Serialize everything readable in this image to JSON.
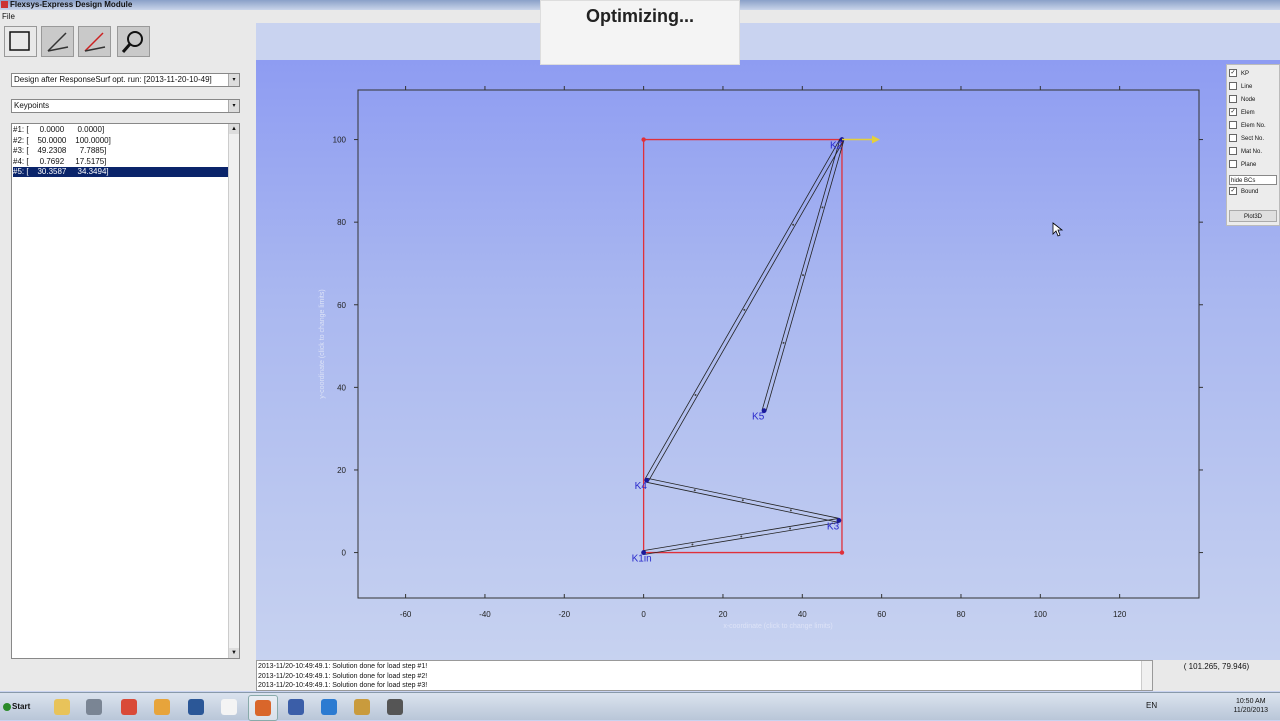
{
  "window": {
    "title": "Flexsys-Express Design Module"
  },
  "menu": {
    "file": "File"
  },
  "status_overlay": {
    "text": "Optimizing..."
  },
  "left": {
    "design_select": "Design after ResponseSurf opt. run: [2013-11-20-10-49]",
    "entity_select": "Keypoints",
    "keypoints": [
      "#1: [     0.0000      0.0000]",
      "#2: [    50.0000    100.0000]",
      "#3: [    49.2308      7.7885]",
      "#4: [     0.7692     17.5175]",
      "#5: [    30.3587     34.3494]"
    ],
    "selected_index": 4
  },
  "options": {
    "checkboxes": [
      {
        "label": "KP",
        "checked": true
      },
      {
        "label": "Line",
        "checked": false
      },
      {
        "label": "Node",
        "checked": false
      },
      {
        "label": "Elem",
        "checked": true
      },
      {
        "label": "Elem No.",
        "checked": false
      },
      {
        "label": "Sect No.",
        "checked": false
      },
      {
        "label": "Mat No.",
        "checked": false
      },
      {
        "label": "Plane",
        "checked": false
      }
    ],
    "bc_select": "hide BCs",
    "bound": {
      "label": "Bound",
      "checked": true
    },
    "plot3d_label": "Plot3D"
  },
  "chart_data": {
    "type": "scatter",
    "xlabel": "x-coordinate (click to change limits)",
    "ylabel": "y-coordinate (click to change limits)",
    "xlim": [
      -72,
      140
    ],
    "ylim": [
      -11,
      112
    ],
    "xticks": [
      -60,
      -40,
      -20,
      0,
      20,
      40,
      60,
      80,
      100,
      120
    ],
    "yticks": [
      0,
      20,
      40,
      60,
      80,
      100
    ],
    "boundary": [
      [
        0,
        0
      ],
      [
        50,
        0
      ],
      [
        50,
        100
      ],
      [
        0,
        100
      ]
    ],
    "keypoints": [
      {
        "label": "K1in",
        "x": 0,
        "y": 0
      },
      {
        "label": "K2",
        "x": 50,
        "y": 100
      },
      {
        "label": "K3",
        "x": 49.2308,
        "y": 7.7885
      },
      {
        "label": "K4",
        "x": 0.7692,
        "y": 17.5175
      },
      {
        "label": "K5",
        "x": 30.3587,
        "y": 34.3494
      }
    ],
    "elements": [
      [
        1,
        3
      ],
      [
        0,
        2
      ],
      [
        2,
        3
      ],
      [
        4,
        1
      ]
    ]
  },
  "log": {
    "lines": [
      "2013-11/20-10:49:49.1: Solution done for load step #1!",
      "2013-11/20-10:49:49.1: Solution done for load step #2!",
      "2013-11/20-10:49:49.1: Solution done for load step #3!"
    ]
  },
  "coords": {
    "text": "( 101.265,  79.946)"
  },
  "taskbar": {
    "start": "Start",
    "lang": "EN",
    "time": "10:50 AM",
    "date": "11/20/2013",
    "apps": [
      {
        "name": "file-explorer-icon",
        "color": "#e8c35a"
      },
      {
        "name": "app-icon",
        "color": "#7a8594"
      },
      {
        "name": "chrome-icon",
        "color": "#d94a38"
      },
      {
        "name": "folder-icon",
        "color": "#e7a43b"
      },
      {
        "name": "word-icon",
        "color": "#2b5797"
      },
      {
        "name": "document-icon",
        "color": "#f4f4f4"
      },
      {
        "name": "matlab-icon",
        "color": "#d9662b"
      },
      {
        "name": "app-3-icon",
        "color": "#3b5ea8"
      },
      {
        "name": "ie-icon",
        "color": "#2c7bd1"
      },
      {
        "name": "image-icon",
        "color": "#c99b3d"
      },
      {
        "name": "window-icon",
        "color": "#555555"
      }
    ]
  }
}
